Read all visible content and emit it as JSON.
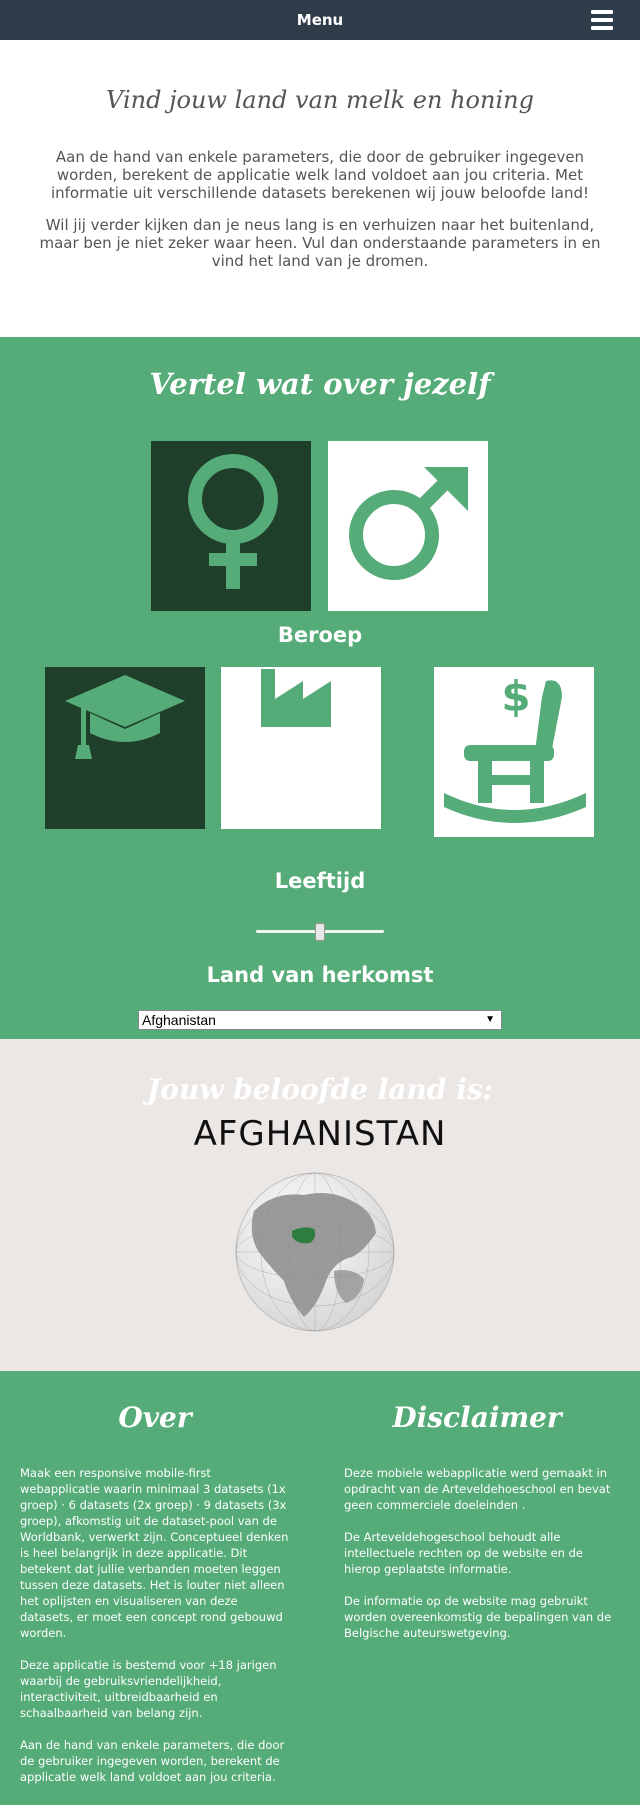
{
  "navbar": {
    "menu_label": "Menu",
    "menu_icon": "hamburger-icon"
  },
  "intro": {
    "title": "Vind jouw land van melk en honing",
    "paragraph1": "Aan de hand van enkele parameters, die door de gebruiker ingegeven worden, berekent de applicatie welk land voldoet aan jou criteria. Met informatie uit verschillende datasets berekenen wij jouw beloofde land!",
    "paragraph2": "Wil jij verder kijken dan je neus lang is en verhuizen naar het buitenland, maar ben je niet zeker waar heen. Vul dan onderstaande parameters in en vind het land van je dromen."
  },
  "about_you": {
    "title": "Vertel wat over jezelf",
    "gender": [
      {
        "icon": "female-icon",
        "selected": true
      },
      {
        "icon": "male-icon",
        "selected": false
      }
    ],
    "occupation_label": "Beroep",
    "occupation": [
      {
        "icon": "graduation-cap-icon",
        "selected": true
      },
      {
        "icon": "factory-icon",
        "selected": false
      },
      {
        "icon": "rocking-chair-icon",
        "selected": false
      }
    ],
    "age_label": "Leeftijd",
    "age_slider_fraction": 0.5,
    "origin_label": "Land van herkomst",
    "origin_value": "Afghanistan"
  },
  "result": {
    "title": "Jouw beloofde land is:",
    "country": "AFGHANISTAN",
    "globe_icon": "globe-icon"
  },
  "footer": {
    "about_title": "Over",
    "about_paragraphs": [
      "Maak een responsive mobile-first webapplicatie waarin minimaal 3 datasets (1x groep) · 6 datasets (2x groep) · 9 datasets (3x groep), afkomstig uit de dataset-pool van de Worldbank, verwerkt zijn. Conceptueel denken is heel belangrijk in deze applicatie. Dit betekent dat jullie verbanden moeten leggen tussen deze datasets. Het is louter niet alleen het oplijsten en visualiseren van deze datasets, er moet een concept rond gebouwd worden.",
      "Deze applicatie is bestemd voor +18 jarigen waarbij de gebruiksvriendelijkheid, interactiviteit, uitbreidbaarheid en schaalbaarheid van belang zijn.",
      "Aan de hand van enkele parameters, die door de gebruiker ingegeven worden, berekent de applicatie welk land voldoet aan jou criteria."
    ],
    "disclaimer_title": "Disclaimer",
    "disclaimer_paragraphs": [
      "Deze mobiele webapplicatie werd gemaakt in opdracht van de Arteveldehoeschool en bevat geen commerciele doeleinden .",
      "De Arteveldehogeschool behoudt alle intellectuele rechten op de website en de hierop geplaatste informatie.",
      "De informatie op de website mag gebruikt worden overeenkomstig de bepalingen van de Belgische auteurswetgeving."
    ]
  }
}
